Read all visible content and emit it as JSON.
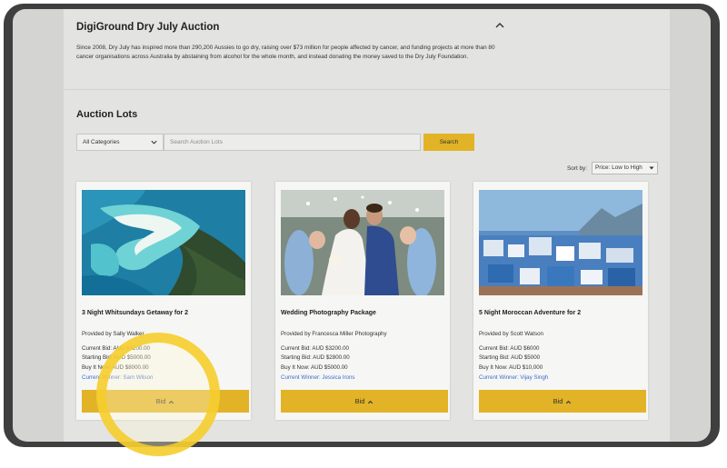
{
  "auction": {
    "title": "DigiGround Dry July Auction",
    "description": "Since 2008, Dry July has inspired more than 290,200 Aussies to go dry, raising over $73 million for people affected by cancer, and funding projects at more than 80 cancer organisations across Australia by abstaining from alcohol for the whole month, and instead donating the money saved to the Dry July Foundation."
  },
  "lots_section": {
    "heading": "Auction Lots",
    "category_selected": "All Categories",
    "search_placeholder": "Search Auction Lots",
    "search_button": "Search",
    "sort_label": "Sort by:",
    "sort_selected": "Price: Low to High"
  },
  "lots": [
    {
      "title": "3 Night Whitsundays Getaway for 2",
      "provider": "Provided by Sally Walker",
      "current_bid": "Current Bid: AUD $3200.00",
      "starting_bid": "Starting Bid: AUD $5000.00",
      "buy_it_now": "Buy It Now: AUD $8000.00",
      "current_winner": "Current Winner: Sam Wilson",
      "bid_label": "Bid"
    },
    {
      "title": "Wedding Photography Package",
      "provider": "Provided by Francesca Miller Photography",
      "current_bid": "Current Bid: AUD $3200.00",
      "starting_bid": "Starting Bid: AUD $2800.00",
      "buy_it_now": "Buy It Now: AUD $5000.00",
      "current_winner": "Current Winner: Jessica Irons",
      "bid_label": "Bid"
    },
    {
      "title": "5 Night Moroccan Adventure for 2",
      "provider": "Provided by Scott Watson",
      "current_bid": "Current Bid: AUD $6000",
      "starting_bid": "Starting Bid: AUD $5000",
      "buy_it_now": "Buy It Now: AUD $10,000",
      "current_winner": "Current Winner: Vijay Singh",
      "bid_label": "Bid"
    }
  ],
  "colors": {
    "accent_yellow": "#e2b326",
    "winner_link": "#3f6bc6",
    "highlight_ring": "#f5cd28"
  },
  "icons": {
    "collapse": "chevron-up-icon",
    "select": "chevron-down-icon",
    "bid": "caret-up-icon"
  }
}
